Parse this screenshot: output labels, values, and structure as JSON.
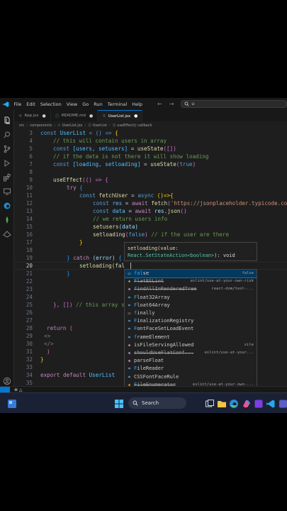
{
  "menu": [
    "File",
    "Edit",
    "Selection",
    "View",
    "Go",
    "Run",
    "Terminal",
    "Help"
  ],
  "search_prefix": "u",
  "tabs": [
    {
      "label": "App.jsx",
      "active": false
    },
    {
      "label": "README.md",
      "active": false
    },
    {
      "label": "UserList.jsx",
      "active": true
    }
  ],
  "breadcrumb": [
    "src",
    "components",
    "UserList.jsx",
    "UserList",
    "useEffect() callback"
  ],
  "editor": {
    "line_numbers": [
      "3",
      "4",
      "5",
      "6",
      "7",
      "8",
      "9",
      "10",
      "11",
      "12",
      "13",
      "14",
      "15",
      "16",
      "17",
      "18",
      "19",
      "20",
      "21",
      "22",
      "23",
      "24",
      "25",
      "26",
      "27",
      "28",
      "29",
      "30",
      "31",
      "32",
      "33",
      "34",
      "35"
    ],
    "current_line": "20",
    "code": {
      "l3": [
        "const",
        "UserList",
        "= () =>",
        "{"
      ],
      "l4": "// this will contain users in array",
      "l5": [
        "const",
        "[users, setusers]",
        "=",
        "useState",
        "([])"
      ],
      "l6": "// if the data is not there it will show loading",
      "l7": [
        "const",
        "[loading, setloading]",
        "=",
        "useState",
        "(",
        "true",
        ")"
      ],
      "l9": [
        "useEffect",
        "(() => {"
      ],
      "l10": [
        "try",
        "{"
      ],
      "l11": [
        "const",
        "fetchUser",
        "=",
        "async",
        "()=>{"
      ],
      "l12": [
        "const",
        "res",
        "=",
        "await",
        "fetch",
        "(",
        "'https://jsonplaceholder.typicode.co"
      ],
      "l13": [
        "const",
        "data",
        "=",
        "await",
        "res",
        ".",
        "json",
        "()"
      ],
      "l14": "// we return users info",
      "l15": [
        "setusers",
        "(data)"
      ],
      "l16": [
        "setloading",
        "(",
        "false",
        ")",
        "// if the user are there"
      ],
      "l17": "}",
      "l19": [
        "}",
        "catch",
        "(error)",
        "{"
      ],
      "l20": [
        "setloading",
        "(",
        "fal"
      ],
      "l21": "}",
      "l25": [
        "}, [])",
        "// this array s"
      ],
      "l28": [
        "return",
        "("
      ],
      "l29": "<>",
      "l30": "</>",
      "l31": ")",
      "l32": "}",
      "l34": [
        "export",
        "default",
        "UserList"
      ]
    }
  },
  "hover": {
    "line1": "setloading(value:",
    "line2_type": "React.SetStateAction<boolean>",
    "line2_rest": "): void"
  },
  "suggestions": [
    {
      "match": "fal",
      "rest": "se",
      "detail": "false",
      "selected": true,
      "strike": false,
      "icon": "keyword-icon"
    },
    {
      "match": "F",
      "rest": "latESLint",
      "detail": "eslint/use-at-your-own-risk",
      "selected": false,
      "strike": true,
      "icon": "class-icon"
    },
    {
      "match": "f",
      "rest": "indAllInRenderedTree",
      "detail": "react-dom/test-...",
      "selected": false,
      "strike": true,
      "icon": "method-icon"
    },
    {
      "match": "F",
      "rest": "loat32Array",
      "detail": "",
      "selected": false,
      "strike": false,
      "icon": "variable-icon"
    },
    {
      "match": "F",
      "rest": "loat64Array",
      "detail": "",
      "selected": false,
      "strike": false,
      "icon": "variable-icon"
    },
    {
      "match": "f",
      "rest": "inally",
      "detail": "",
      "selected": false,
      "strike": false,
      "icon": "keyword-icon"
    },
    {
      "match": "F",
      "rest": "inalizationRegistry",
      "detail": "",
      "selected": false,
      "strike": false,
      "icon": "variable-icon"
    },
    {
      "match": "F",
      "rest": "ontFaceSetLoadEvent",
      "detail": "",
      "selected": false,
      "strike": false,
      "icon": "variable-icon"
    },
    {
      "match": "f",
      "rest": "rameElement",
      "detail": "",
      "selected": false,
      "strike": false,
      "icon": "variable-icon"
    },
    {
      "match": "",
      "rest": "isFileServingAllowed",
      "detail": "vite",
      "selected": false,
      "strike": false,
      "icon": "method-icon"
    },
    {
      "match": "",
      "rest": "shouldUseFlatConf...",
      "detail": "eslint/use-at-your...",
      "selected": false,
      "strike": true,
      "icon": "method-icon"
    },
    {
      "match": "",
      "rest": "parseFloat",
      "detail": "",
      "selected": false,
      "strike": false,
      "icon": "method-icon"
    },
    {
      "match": "F",
      "rest": "ileReader",
      "detail": "",
      "selected": false,
      "strike": false,
      "icon": "variable-icon"
    },
    {
      "match": "",
      "rest": "CSSFontFaceRule",
      "detail": "",
      "selected": false,
      "strike": false,
      "icon": "variable-icon"
    },
    {
      "match": "F",
      "rest": "ileEnumerator",
      "detail": "eslint/use-at-your-own-...",
      "selected": false,
      "strike": true,
      "icon": "class-icon"
    }
  ],
  "taskbar": {
    "search_label": "Search"
  },
  "colors": {
    "accent": "#0078d4",
    "keyword": "#569cd6",
    "comment": "#6a9955",
    "string": "#ce9178"
  }
}
